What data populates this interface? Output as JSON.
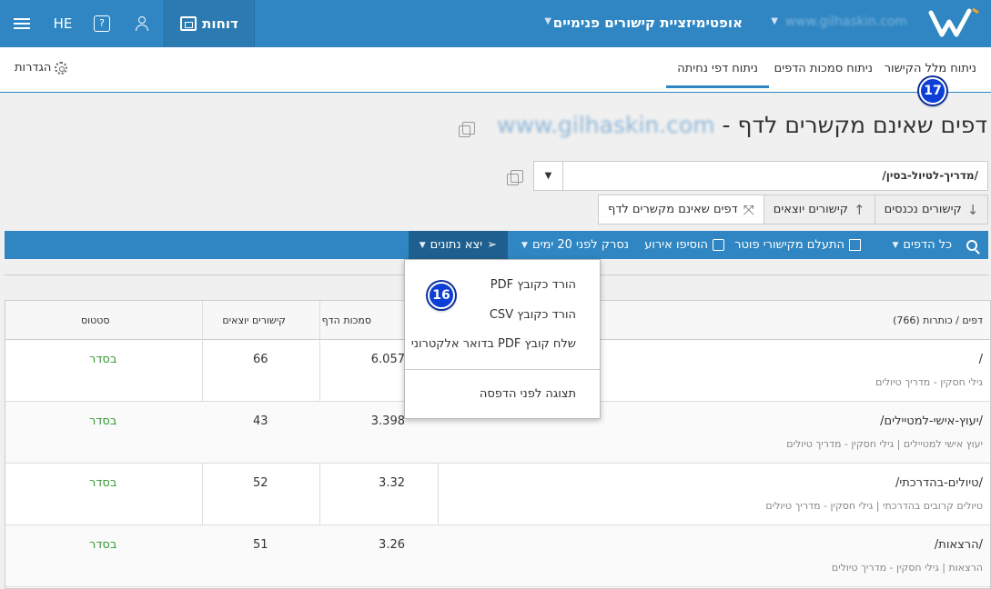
{
  "topbar": {
    "site_name": "www.gilhaskin.com",
    "product": "אופטימיזציית קישורים פנימיים",
    "reports_label": "דוחות",
    "lang": "HE",
    "brand_color": "#2f86c2"
  },
  "subnav": {
    "tabs": [
      {
        "label": "ניתוח מלל הקישור",
        "active": false
      },
      {
        "label": "ניתוח סמכות הדפים",
        "active": false
      },
      {
        "label": "ניתוח דפי נחיתה",
        "active": true
      }
    ],
    "settings_label": "הגדרות"
  },
  "badges": {
    "b17": "17",
    "b16": "16"
  },
  "page": {
    "title_prefix": "דפים שאינם מקשרים לדף - ",
    "title_site": "www.gilhaskin.com",
    "url_value": "/מדריך-לטיול-בסין/"
  },
  "segments": {
    "incoming": "קישורים נכנסים",
    "outgoing": "קישורים יוצאים",
    "not_linking": "דפים שאינם מקשרים לדף"
  },
  "toolbar": {
    "all_pages": "כל הדפים",
    "ignore_footer": "התעלם מקישורי פוטר",
    "add_event": "הוסיפו אירוע",
    "crawled": "נסרק לפני 20 ימים",
    "export": "יצא נתונים"
  },
  "table": {
    "headers": {
      "pages": "דפים / כותרות (766)",
      "authority": "סמכות הדף",
      "outgoing": "קישורים יוצאים",
      "status": "סטטוס"
    },
    "rows": [
      {
        "path": "/",
        "desc": "גילי חסקין - מדריך טיולים",
        "score": "6.057",
        "links": "66",
        "status": "בסדר"
      },
      {
        "path": "/יעוץ-אישי-למטיילים/",
        "desc": "יעוץ אישי למטיילים | גילי חסקין - מדריך טיולים",
        "score": "3.398",
        "links": "43",
        "status": "בסדר"
      },
      {
        "path": "/טיולים-בהדרכתי/",
        "desc": "טיולים קרובים בהדרכתי | גילי חסקין - מדריך טיולים",
        "score": "3.32",
        "links": "52",
        "status": "בסדר"
      },
      {
        "path": "/הרצאות/",
        "desc": "הרצאות | גילי חסקין - מדריך טיולים",
        "score": "3.26",
        "links": "51",
        "status": "בסדר"
      }
    ]
  },
  "export_menu": {
    "pdf": "הורד כקובץ PDF",
    "csv": "הורד כקובץ CSV",
    "email": "שלח קובץ PDF בדואר אלקטרוני",
    "print": "תצוגה לפני הדפסה"
  }
}
